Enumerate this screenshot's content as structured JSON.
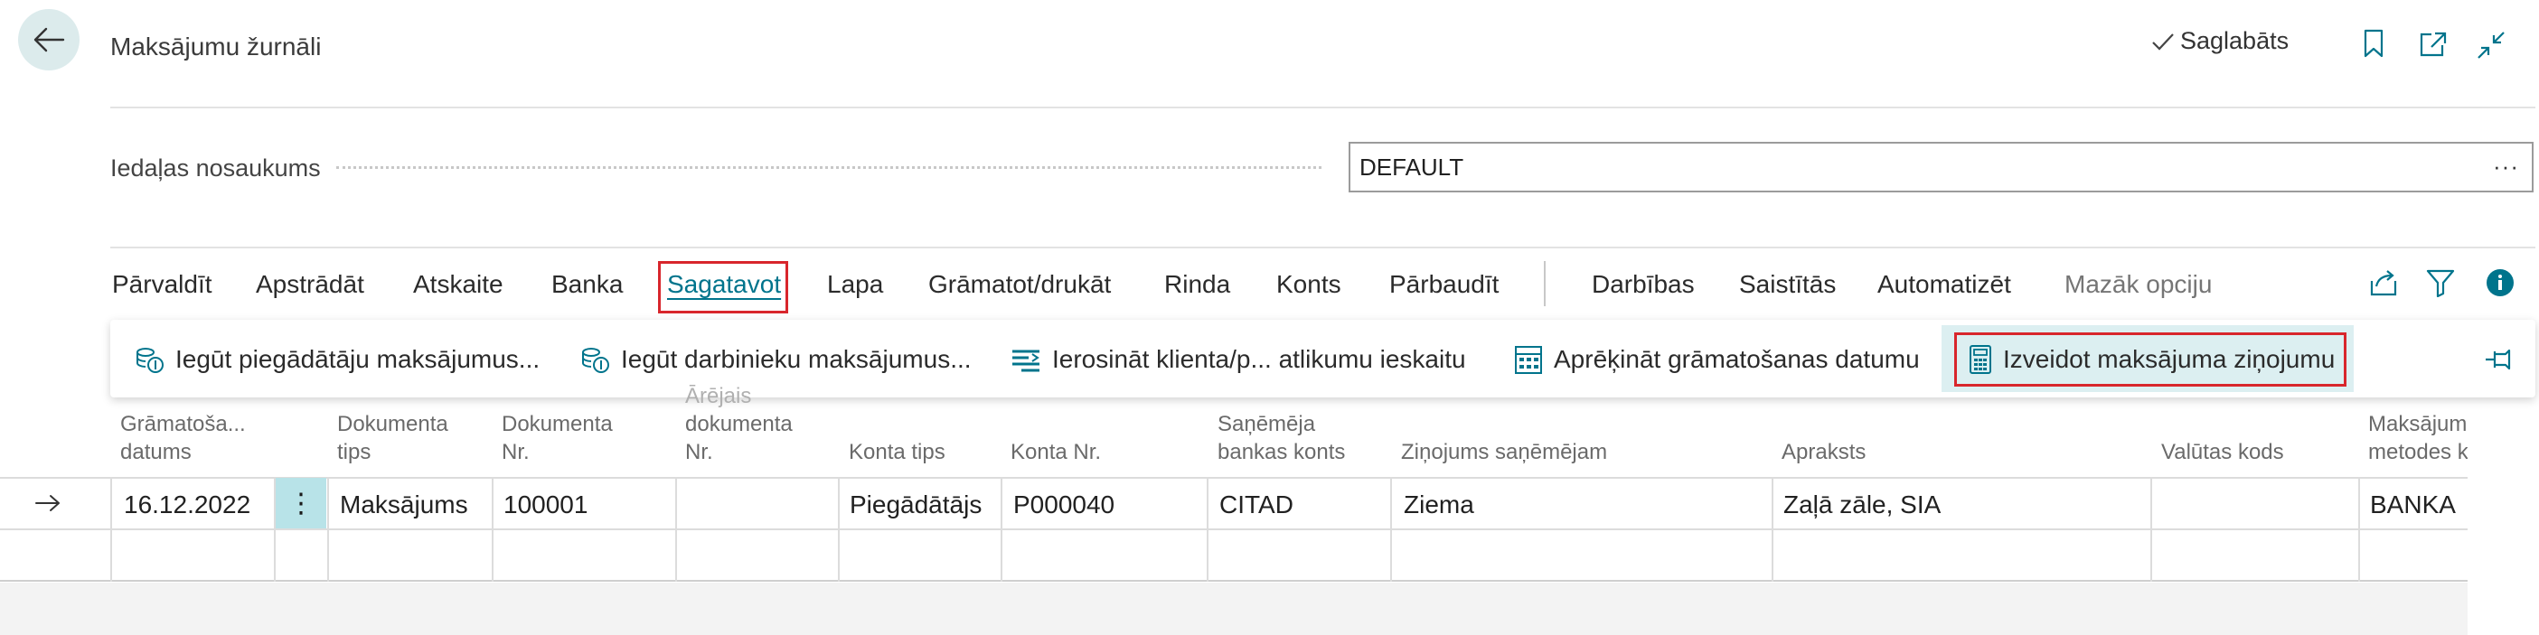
{
  "header": {
    "title": "Maksājumu žurnāli",
    "saved_label": "Saglabāts"
  },
  "batch_field": {
    "label": "Iedaļas nosaukums",
    "value": "DEFAULT",
    "ellipsis": "···"
  },
  "tabs": [
    {
      "label": "Pārvaldīt"
    },
    {
      "label": "Apstrādāt"
    },
    {
      "label": "Atskaite"
    },
    {
      "label": "Banka"
    },
    {
      "label": "Sagatavot"
    },
    {
      "label": "Lapa"
    },
    {
      "label": "Grāmatot/drukāt"
    },
    {
      "label": "Rinda"
    },
    {
      "label": "Konts"
    },
    {
      "label": "Pārbaudīt"
    },
    {
      "label": "Darbības"
    },
    {
      "label": "Saistītās"
    },
    {
      "label": "Automatizēt"
    },
    {
      "label": "Mazāk opciju"
    }
  ],
  "actions": [
    {
      "label": "Iegūt piegādātāju maksājumus..."
    },
    {
      "label": "Iegūt darbinieku maksājumus..."
    },
    {
      "label": "Ierosināt klienta/p... atlikumu ieskaitu"
    },
    {
      "label": "Aprēķināt grāmatošanas datumu"
    },
    {
      "label": "Izveidot maksājuma ziņojumu"
    }
  ],
  "grid": {
    "columns": [
      {
        "l1": "Grāmatoša...",
        "l2": "datums"
      },
      {
        "l1": "Dokumenta",
        "l2": "tips"
      },
      {
        "l1": "Dokumenta",
        "l2": "Nr."
      },
      {
        "l0": "Ārējais",
        "l1": "dokumenta",
        "l2": "Nr."
      },
      {
        "l2": "Konta tips"
      },
      {
        "l2": "Konta Nr."
      },
      {
        "l1": "Saņēmēja",
        "l2": "bankas konts"
      },
      {
        "l2": "Ziņojums saņēmējam"
      },
      {
        "l2": "Apraksts"
      },
      {
        "l2": "Valūtas kods"
      },
      {
        "l1": "Maksājum",
        "l2": "metodes k"
      }
    ],
    "row": {
      "posting_date": "16.12.2022",
      "document_type": "Maksājums",
      "document_no": "100001",
      "external_doc_no": "",
      "account_type": "Piegādātājs",
      "account_no": "P000040",
      "recipient_bank": "CITAD",
      "message": "Ziema",
      "description": "Zaļā zāle, SIA",
      "currency": "",
      "payment_method": "BANKA"
    }
  },
  "colors": {
    "accent": "#00748c",
    "highlight_border": "#d8262c",
    "selected_bg": "#dceff1"
  }
}
